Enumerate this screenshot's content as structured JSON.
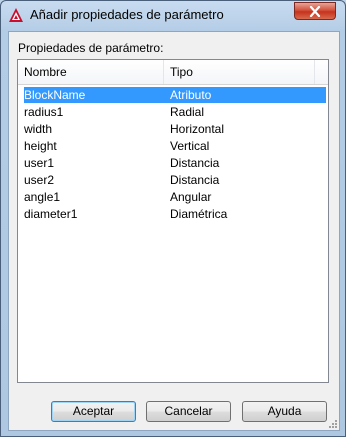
{
  "window": {
    "title": "Añadir propiedades de parámetro",
    "icon": "autocad-icon"
  },
  "section_label": "Propiedades de parámetro:",
  "table": {
    "columns": [
      "Nombre",
      "Tipo"
    ],
    "rows": [
      {
        "name": "BlockName",
        "type": "Atributo",
        "selected": true
      },
      {
        "name": "radius1",
        "type": "Radial"
      },
      {
        "name": "width",
        "type": "Horizontal"
      },
      {
        "name": "height",
        "type": "Vertical"
      },
      {
        "name": "user1",
        "type": "Distancia"
      },
      {
        "name": "user2",
        "type": "Distancia"
      },
      {
        "name": "angle1",
        "type": "Angular"
      },
      {
        "name": "diameter1",
        "type": "Diamétrica"
      }
    ]
  },
  "buttons": {
    "accept": "Aceptar",
    "cancel": "Cancelar",
    "help": "Ayuda"
  },
  "colors": {
    "selection": "#3399ff",
    "close_button": "#c7321c"
  }
}
